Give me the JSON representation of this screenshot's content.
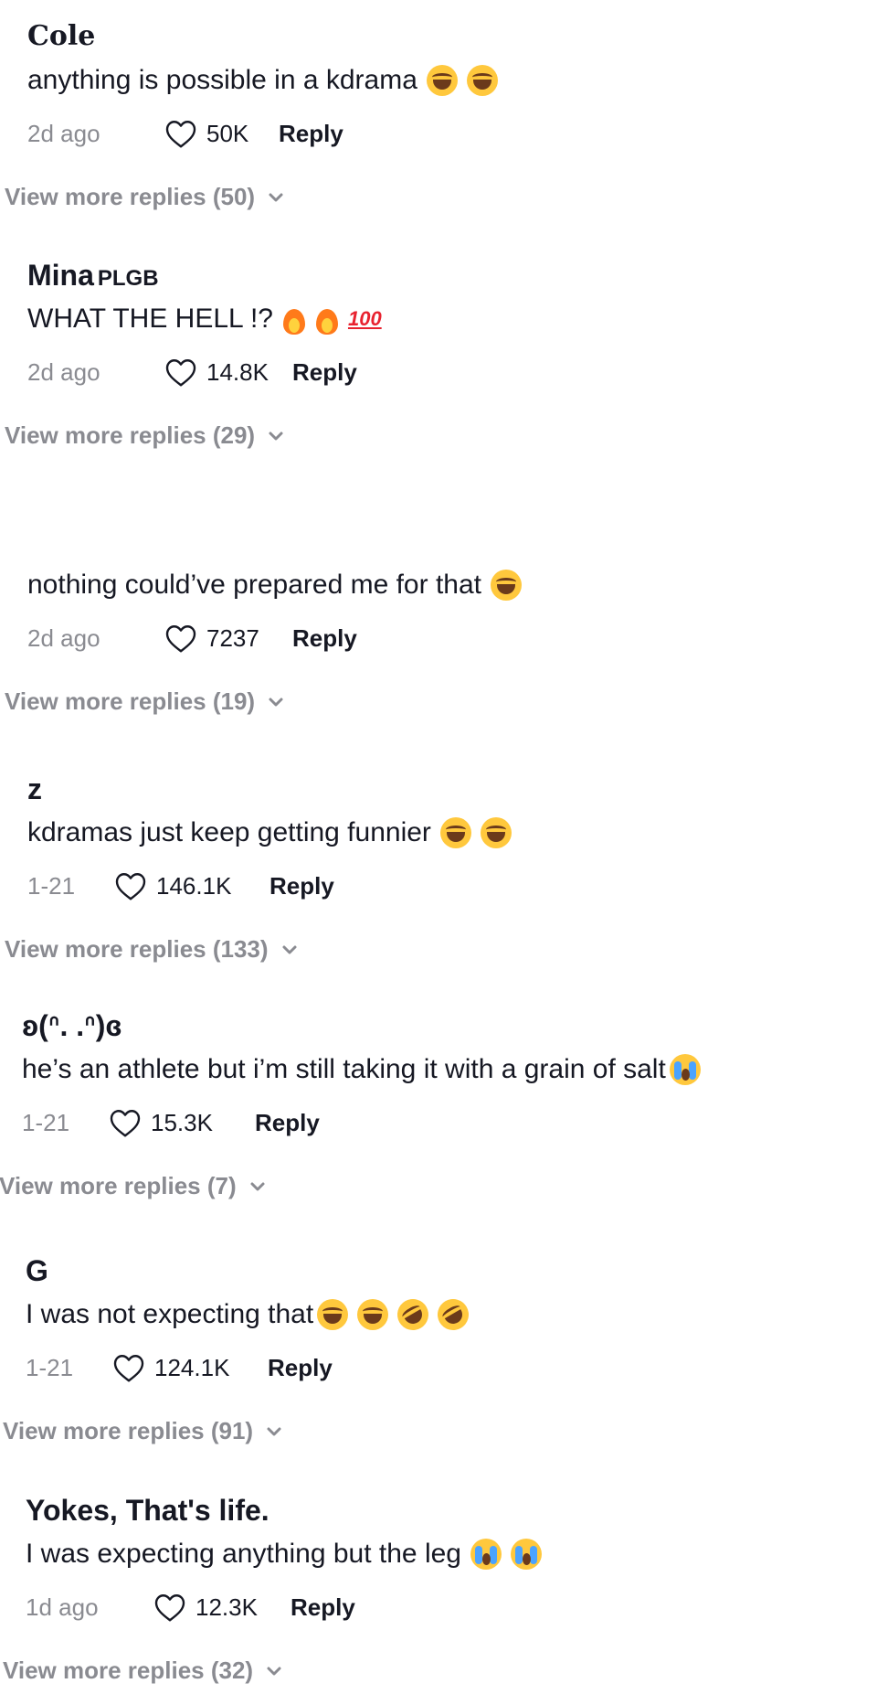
{
  "comments": [
    {
      "author": "Cole",
      "author_suffix": "",
      "text": "anything is possible in a kdrama",
      "emojis": [
        "laugh",
        "laugh"
      ],
      "time": "2d ago",
      "likes": "50K",
      "reply_label": "Reply",
      "more_replies": "View more replies (50)"
    },
    {
      "author": "Mina",
      "author_suffix": "PLGB",
      "text": "WHAT THE HELL !?",
      "emojis": [
        "fire",
        "fire",
        "hundred"
      ],
      "time": "2d ago",
      "likes": "14.8K",
      "reply_label": "Reply",
      "more_replies": "View more replies (29)"
    },
    {
      "author": "",
      "author_suffix": "",
      "text": "nothing could’ve prepared me for that",
      "emojis": [
        "laugh"
      ],
      "time": "2d ago",
      "likes": "7237",
      "reply_label": "Reply",
      "more_replies": "View more replies (19)"
    },
    {
      "author": "z",
      "author_suffix": "",
      "text": "kdramas just keep getting funnier",
      "emojis": [
        "laugh",
        "laugh"
      ],
      "time": "1-21",
      "likes": "146.1K",
      "reply_label": "Reply",
      "more_replies": "View more replies (133)"
    },
    {
      "author": "ʚ(ᐢ. .ᐢ)ɞ",
      "author_suffix": "",
      "text": "he’s an athlete but i’m still taking it with a grain of salt",
      "emojis": [
        "cry"
      ],
      "time": "1-21",
      "likes": "15.3K",
      "reply_label": "Reply",
      "more_replies": "View more replies (7)"
    },
    {
      "author": "G",
      "author_suffix": "",
      "text": "I was not expecting that",
      "emojis": [
        "laugh",
        "laugh",
        "rofl",
        "rofl"
      ],
      "time": "1-21",
      "likes": "124.1K",
      "reply_label": "Reply",
      "more_replies": "View more replies (91)"
    },
    {
      "author": "Yokes, That's life.",
      "author_suffix": "",
      "text": "I was expecting anything but the leg",
      "emojis": [
        "cry",
        "cry"
      ],
      "time": "1d ago",
      "likes": "12.3K",
      "reply_label": "Reply",
      "more_replies": "View more replies (32)"
    }
  ],
  "icons": {
    "like": "heart-outline-icon",
    "expand": "chevron-down-icon"
  },
  "colors": {
    "text": "#161823",
    "muted": "#8a8b91",
    "background": "#ffffff"
  }
}
